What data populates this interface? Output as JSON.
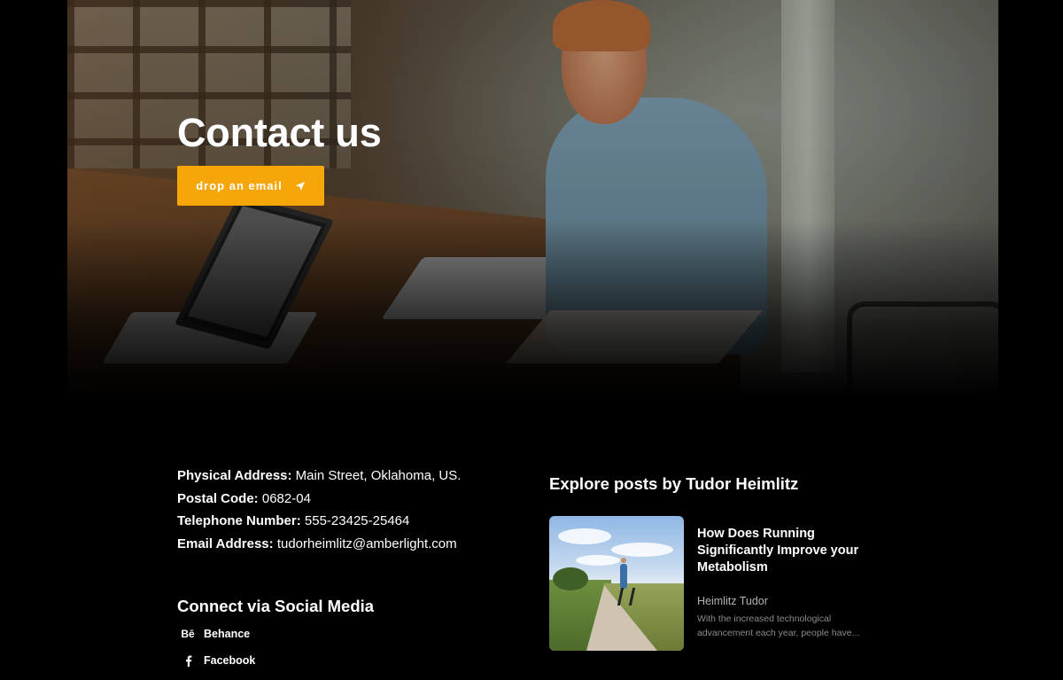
{
  "hero": {
    "title": "Contact us",
    "button_label": "drop an email",
    "button_icon": "paper-plane-icon",
    "button_color": "#f6a609"
  },
  "contact": {
    "rows": [
      {
        "label": "Physical Address:",
        "value": "Main Street, Oklahoma, US."
      },
      {
        "label": "Postal Code:",
        "value": "0682-04"
      },
      {
        "label": "Telephone Number:",
        "value": "555-23425-25464"
      },
      {
        "label": "Email Address:",
        "value": "tudorheimlitz@amberlight.com"
      }
    ]
  },
  "social": {
    "title": "Connect via Social Media",
    "links": [
      {
        "icon": "behance-icon",
        "glyph": "Bē",
        "label": "Behance"
      },
      {
        "icon": "facebook-icon",
        "glyph": "",
        "label": "Facebook"
      }
    ]
  },
  "posts": {
    "title": "Explore posts by Tudor Heimlitz",
    "items": [
      {
        "title": "How Does Running Significantly Improve your Metabolism",
        "author": "Heimlitz Tudor",
        "excerpt": "With the increased technological advancement each year, people have..."
      }
    ]
  }
}
